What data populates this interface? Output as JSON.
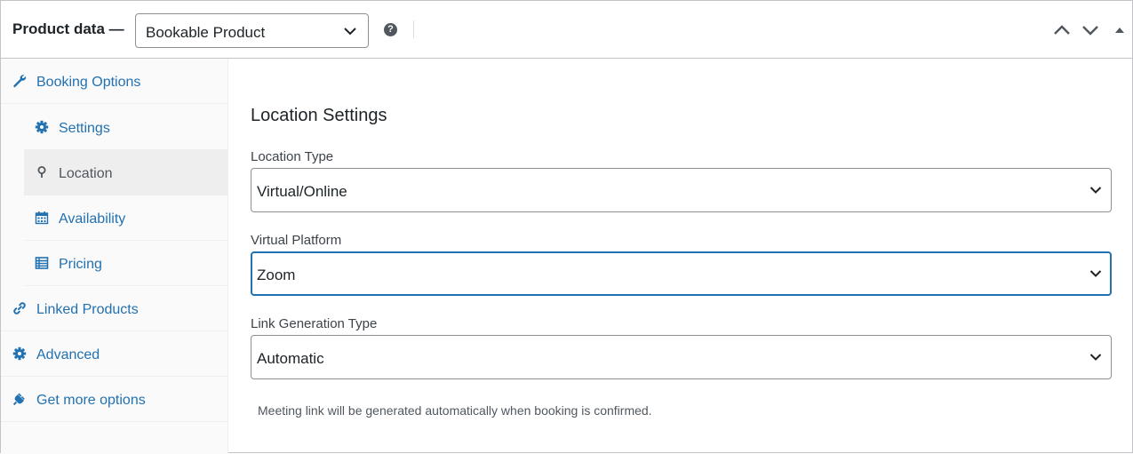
{
  "header": {
    "title": "Product data —",
    "product_type": "Bookable Product",
    "help_symbol": "?",
    "help_icon": "question-circle-icon",
    "controls": [
      "chevron-up-icon",
      "chevron-down-icon",
      "caret-up-icon"
    ]
  },
  "sidebar": {
    "items": [
      {
        "label": "Booking Options",
        "icon": "wrench-icon"
      },
      {
        "label": "Settings",
        "icon": "gear-icon"
      },
      {
        "label": "Location",
        "icon": "map-pin-icon"
      },
      {
        "label": "Availability",
        "icon": "calendar-icon"
      },
      {
        "label": "Pricing",
        "icon": "table-icon"
      },
      {
        "label": "Linked Products",
        "icon": "link-icon"
      },
      {
        "label": "Advanced",
        "icon": "gear-icon"
      },
      {
        "label": "Get more options",
        "icon": "plugin-icon"
      }
    ],
    "active": "Location"
  },
  "main": {
    "title": "Location Settings",
    "fields": [
      {
        "label": "Location Type",
        "value": "Virtual/Online"
      },
      {
        "label": "Virtual Platform",
        "value": "Zoom"
      },
      {
        "label": "Link Generation Type",
        "value": "Automatic"
      }
    ],
    "help_text": "Meeting link will be generated automatically when booking is confirmed."
  },
  "colors": {
    "link": "#2271b1",
    "text": "#1d2327",
    "muted": "#50575e",
    "border": "#c3c4c7",
    "focus": "#2271b1",
    "sidebar_bg": "#fafafa",
    "active_bg": "#eeeeee"
  }
}
